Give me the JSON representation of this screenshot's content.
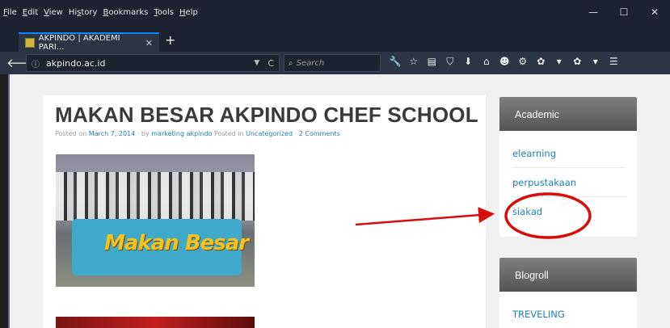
{
  "menubar": {
    "items": [
      "File",
      "Edit",
      "View",
      "History",
      "Bookmarks",
      "Tools",
      "Help"
    ],
    "underlines": [
      "F",
      "E",
      "V",
      "s",
      "B",
      "T",
      "H"
    ],
    "window_controls": [
      "—",
      "☐",
      "✕"
    ]
  },
  "tab": {
    "title": "AKPINDO | AKADEMI PARI...",
    "close": "✕",
    "new_tab": "+"
  },
  "navbar": {
    "back": "🡐",
    "info": "ⓘ",
    "url": "akpindo.ac.id",
    "dropdown": "▼",
    "reload": "C",
    "search_placeholder": "Search",
    "search_icon": "🔍",
    "tool_icons": [
      "wrench-icon",
      "star-icon",
      "reader-icon",
      "pocket-icon",
      "download-icon",
      "home-icon",
      "emoji-icon",
      "extension-icon",
      "addon-icon",
      "dropdown-icon",
      "addon2-icon",
      "dropdown-icon",
      "menu-icon"
    ],
    "tool_glyphs": [
      "🔧",
      "☆",
      "▤",
      "⛉",
      "⬇",
      "⌂",
      "☻",
      "⚙",
      "✿",
      "▾",
      "✿",
      "▾",
      "☰"
    ]
  },
  "article": {
    "title": "MAKAN BESAR AKPINDO CHEF SCHOOL",
    "meta_posted_on": "Posted on",
    "meta_date": "March 7, 2014",
    "meta_by": "· by",
    "meta_author": "marketing akpindo",
    "meta_posted_in": "Posted in",
    "meta_category": "Uncategorized",
    "meta_sep": "·",
    "meta_comments": "2 Comments",
    "photo_sign_text": "Makan Besar"
  },
  "sidebar": {
    "academic": {
      "title": "Academic",
      "links": [
        "elearning",
        "perpustakaan",
        "siakad"
      ]
    },
    "blogroll": {
      "title": "Blogroll",
      "links": [
        "TREVELING"
      ]
    }
  },
  "annotation": {
    "color": "#d90c0c"
  }
}
